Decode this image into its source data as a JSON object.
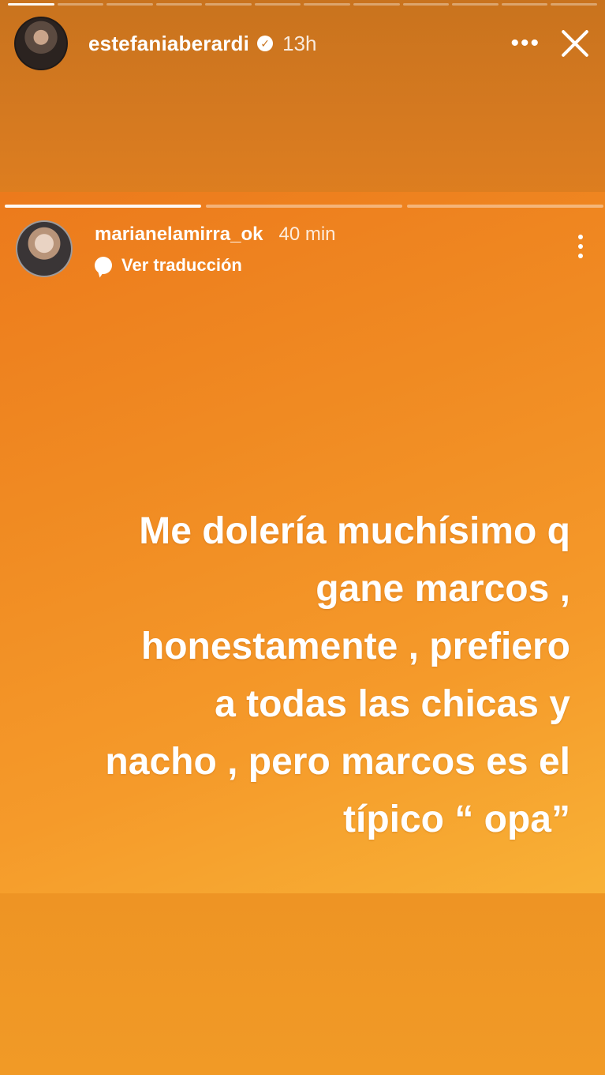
{
  "outer_story": {
    "progress_segments": 12,
    "active_segment": 0,
    "username": "estefaniaberardi",
    "verified": true,
    "time": "13h",
    "more_label": "•••"
  },
  "inner_story": {
    "progress_segments": 3,
    "active_segment": 0,
    "username": "marianelamirra_ok",
    "time": "40 min",
    "translate_label": "Ver traducción",
    "text_lines": [
      "Me dolería muchísimo q",
      "gane marcos ,",
      "honestamente , prefiero",
      "a todas las chicas y",
      "nacho , pero marcos es el",
      "típico  “ opa”"
    ]
  },
  "colors": {
    "background_top": "#c9731e",
    "story_orange": "#f08a22",
    "story_yellow": "#f8b136"
  }
}
